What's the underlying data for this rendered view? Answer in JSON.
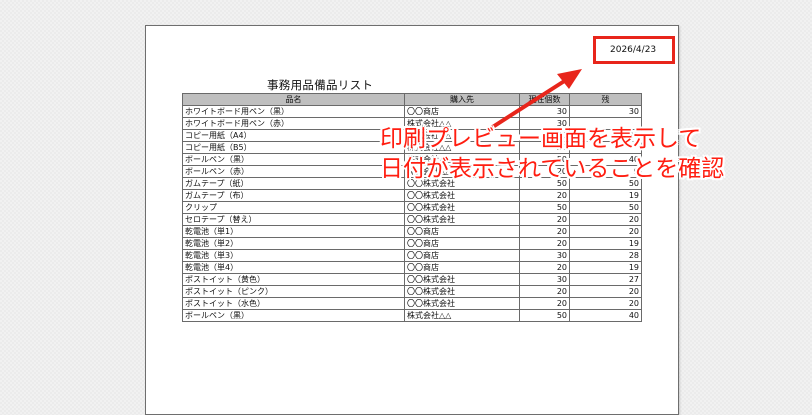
{
  "colors": {
    "highlight": "#e8251b",
    "callout_text": "#ff1d10",
    "header_bg": "#bfbfbf"
  },
  "document": {
    "date": "2026/4/23",
    "title": "事務用品備品リスト",
    "columns": [
      "品名",
      "購入先",
      "現在個数",
      "残"
    ],
    "rows": [
      [
        "ホワイトボード用ペン（黒）",
        "〇〇商店",
        "30",
        "30"
      ],
      [
        "ホワイトボード用ペン（赤）",
        "株式会社△△",
        "30",
        ""
      ],
      [
        "コピー用紙（A4）",
        "株式会社△△",
        "30",
        "25"
      ],
      [
        "コピー用紙（B5）",
        "株式会社△△",
        "20",
        ""
      ],
      [
        "ボールペン（黒）",
        "株式会社△△",
        "50",
        "40"
      ],
      [
        "ボールペン（赤）",
        "株式会社△△",
        "20",
        "9"
      ],
      [
        "ガムテープ（紙）",
        "〇〇株式会社",
        "50",
        "50"
      ],
      [
        "ガムテープ（布）",
        "〇〇株式会社",
        "20",
        "19"
      ],
      [
        "クリップ",
        "〇〇株式会社",
        "50",
        "50"
      ],
      [
        "セロテープ（替え）",
        "〇〇株式会社",
        "20",
        "20"
      ],
      [
        "乾電池（単1）",
        "〇〇商店",
        "20",
        "20"
      ],
      [
        "乾電池（単2）",
        "〇〇商店",
        "20",
        "19"
      ],
      [
        "乾電池（単3）",
        "〇〇商店",
        "30",
        "28"
      ],
      [
        "乾電池（単4）",
        "〇〇商店",
        "20",
        "19"
      ],
      [
        "ポストイット（黄色）",
        "〇〇株式会社",
        "30",
        "27"
      ],
      [
        "ポストイット（ピンク）",
        "〇〇株式会社",
        "20",
        "20"
      ],
      [
        "ポストイット（水色）",
        "〇〇株式会社",
        "20",
        "20"
      ],
      [
        "ボールペン（黒）",
        "株式会社△△",
        "50",
        "40"
      ]
    ]
  },
  "annotation": {
    "line1": "印刷プレビュー画面を表示して",
    "line2": "日付が表示されていることを確認"
  }
}
